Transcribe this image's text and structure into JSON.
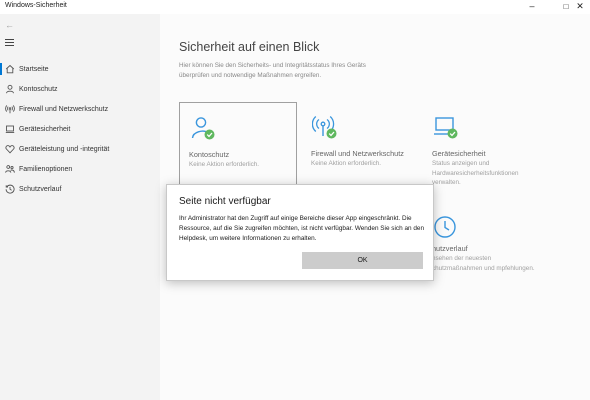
{
  "window": {
    "title": "Windows-Sicherheit",
    "minimize_glyph": "–",
    "maximize_glyph": "□",
    "close_glyph": "✕"
  },
  "sidebar": {
    "back_glyph": "←",
    "items": [
      {
        "label": "Startseite",
        "icon": "home-icon",
        "active": true
      },
      {
        "label": "Kontoschutz",
        "icon": "person-icon"
      },
      {
        "label": "Firewall und Netzwerkschutz",
        "icon": "antenna-icon"
      },
      {
        "label": "Gerätesicherheit",
        "icon": "laptop-icon"
      },
      {
        "label": "Geräteleistung und -integrität",
        "icon": "heart-icon"
      },
      {
        "label": "Familienoptionen",
        "icon": "family-icon"
      },
      {
        "label": "Schutzverlauf",
        "icon": "history-icon"
      }
    ]
  },
  "main": {
    "title": "Sicherheit auf einen Blick",
    "description": "Hier können Sie den Sicherheits- und Integritätsstatus Ihres Geräts überprüfen und notwendige Maßnahmen ergreifen.",
    "cards": [
      {
        "title": "Kontoschutz",
        "subtitle": "Keine Aktion erforderlich.",
        "icon": "person-check-icon"
      },
      {
        "title": "Firewall und Netzwerkschutz",
        "subtitle": "Keine Aktion erforderlich.",
        "icon": "antenna-check-icon"
      },
      {
        "title": "Gerätesicherheit",
        "subtitle": "Status anzeigen und Hardwaresicherheitsfunktionen verwalten.",
        "icon": "laptop-check-icon"
      },
      {
        "title": "hutzverlauf",
        "subtitle": "nsehen der neuesten chutzmaßnahmen und mpfehlungen.",
        "icon": "clock-icon"
      }
    ]
  },
  "dialog": {
    "title": "Seite nicht verfügbar",
    "message": "Ihr Administrator hat den Zugriff auf einige Bereiche dieser App eingeschränkt. Die Ressource, auf die Sie zugreifen möchten, ist nicht verfügbar. Wenden Sie sich an den Helpdesk, um weitere Informationen zu erhalten.",
    "ok_label": "OK"
  },
  "colors": {
    "accent": "#0078d4",
    "icon_blue": "#3a96dd",
    "ok_green": "#5fb85f",
    "sidebar_bg": "#f3f3f3",
    "content_bg": "#fbfbfb"
  }
}
